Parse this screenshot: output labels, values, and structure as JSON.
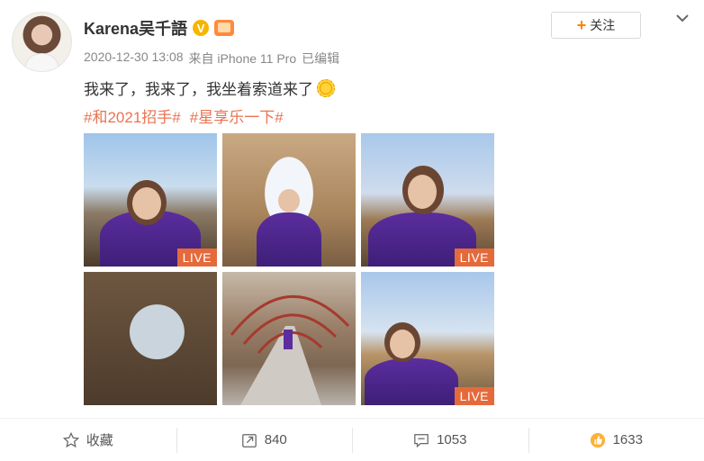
{
  "post": {
    "username": "Karena吴千語",
    "verified_mark": "V",
    "timestamp": "2020-12-30 13:08",
    "source": "来自 iPhone 11 Pro",
    "edited": "已编辑",
    "text": "我来了，我来了，我坐着索道来了",
    "tags": [
      "#和2021招手#",
      "#星享乐一下#"
    ]
  },
  "header": {
    "follow_label": "关注"
  },
  "photos": [
    {
      "live_label": "LIVE"
    },
    {
      "live_label": ""
    },
    {
      "live_label": "LIVE"
    },
    {
      "live_label": ""
    },
    {
      "live_label": ""
    },
    {
      "live_label": "LIVE"
    }
  ],
  "actions": {
    "favorite_label": "收藏",
    "repost_count": "840",
    "comment_count": "1053",
    "like_count": "1633"
  },
  "colors": {
    "accent": "#ff8200",
    "tag": "#eb7350",
    "live_badge": "#e56a3b"
  },
  "icons": {
    "follow": "plus-icon",
    "more": "chevron-down-icon",
    "favorite": "star-icon",
    "repost": "repost-icon",
    "comment": "comment-icon",
    "like": "like-icon",
    "text_emoji": "sun-emoji-icon"
  }
}
